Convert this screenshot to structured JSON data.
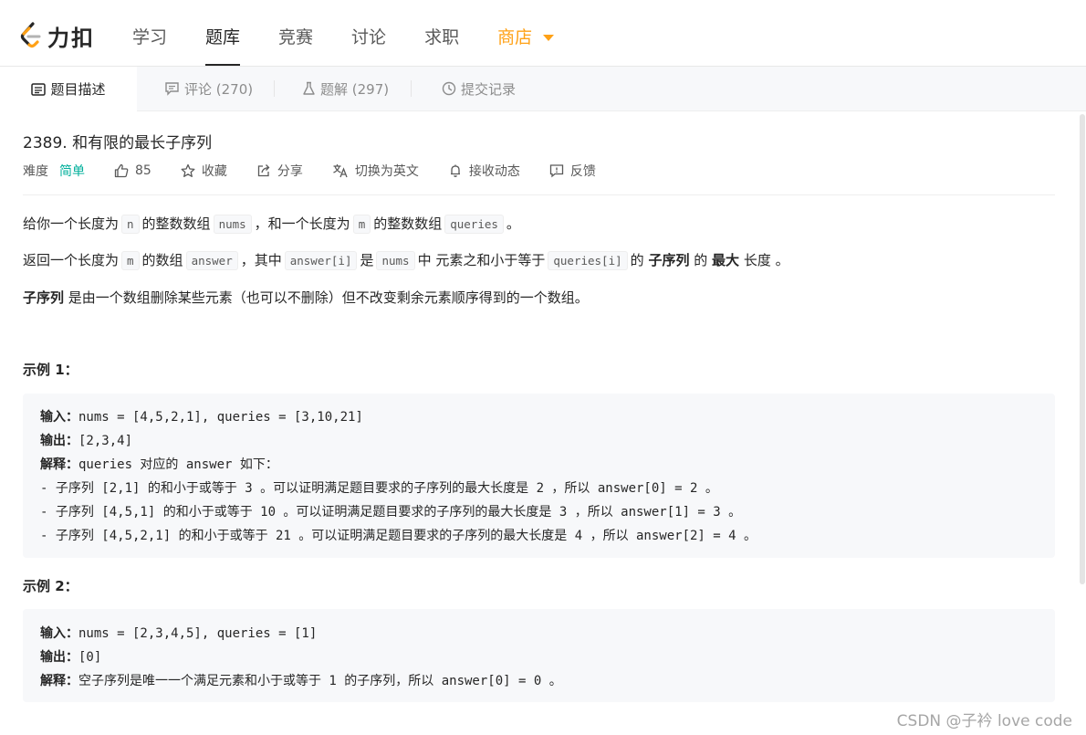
{
  "brand": {
    "name": "力扣"
  },
  "nav": {
    "items": [
      "学习",
      "题库",
      "竞赛",
      "讨论",
      "求职"
    ],
    "active_index": 1,
    "shop": "商店"
  },
  "tabs": [
    {
      "label": "题目描述"
    },
    {
      "label": "评论 (270)"
    },
    {
      "label": "题解 (297)"
    },
    {
      "label": "提交记录"
    }
  ],
  "problem": {
    "title": "2389. 和有限的最长子序列",
    "difficulty_label": "难度",
    "difficulty": "简单",
    "likes": "85",
    "favorite": "收藏",
    "share": "分享",
    "switch_lang": "切换为英文",
    "subscribe": "接收动态",
    "feedback": "反馈"
  },
  "description": {
    "p1": {
      "t1": "给你一个长度为",
      "c1": "n",
      "t2": "的整数数组",
      "c2": "nums",
      "t3": "，和一个长度为",
      "c3": "m",
      "t4": "的整数数组",
      "c4": "queries",
      "t5": "。"
    },
    "p2": {
      "t1": "返回一个长度为",
      "c1": "m",
      "t2": "的数组",
      "c2": "answer",
      "t3": "，其中",
      "c3": "answer[i]",
      "t4": "是",
      "c4": "nums",
      "t5": "中 元素之和小于等于",
      "c5": "queries[i]",
      "t6": "的",
      "s1": "子序列",
      "t7": "的",
      "s2": "最大",
      "t8": "长度 。"
    },
    "p3": {
      "s1": "子序列",
      "t1": "是由一个数组删除某些元素（也可以不删除）但不改变剩余元素顺序得到的一个数组。"
    }
  },
  "examples": [
    {
      "title": "示例 1：",
      "input_label": "输入：",
      "input": "nums = [4,5,2,1], queries = [3,10,21]",
      "output_label": "输出：",
      "output": "[2,3,4]",
      "explain_label": "解释：",
      "explain": "queries 对应的 answer 如下：",
      "extra": [
        "- 子序列 [2,1] 的和小于或等于 3 。可以证明满足题目要求的子序列的最大长度是 2 ，所以 answer[0] = 2 。",
        "- 子序列 [4,5,1] 的和小于或等于 10 。可以证明满足题目要求的子序列的最大长度是 3 ，所以 answer[1] = 3 。",
        "- 子序列 [4,5,2,1] 的和小于或等于 21 。可以证明满足题目要求的子序列的最大长度是 4 ，所以 answer[2] = 4 。"
      ]
    },
    {
      "title": "示例 2：",
      "input_label": "输入：",
      "input": "nums = [2,3,4,5], queries = [1]",
      "output_label": "输出：",
      "output": "[0]",
      "explain_label": "解释：",
      "explain": "空子序列是唯一一个满足元素和小于或等于 1 的子序列，所以 answer[0] = 0 。"
    }
  ],
  "watermark": "CSDN @子衿 love code",
  "colors": {
    "accent": "#ffa116",
    "easy": "#00af9b",
    "text": "#262626",
    "muted": "#8c8c8c"
  },
  "icons": {
    "logo": "leetcode-logo-icon",
    "caret": "caret-down-icon",
    "like": "thumbs-up-icon",
    "star": "star-icon",
    "share": "share-icon",
    "translate": "translate-icon",
    "bell": "bell-icon",
    "feedback": "feedback-icon"
  }
}
